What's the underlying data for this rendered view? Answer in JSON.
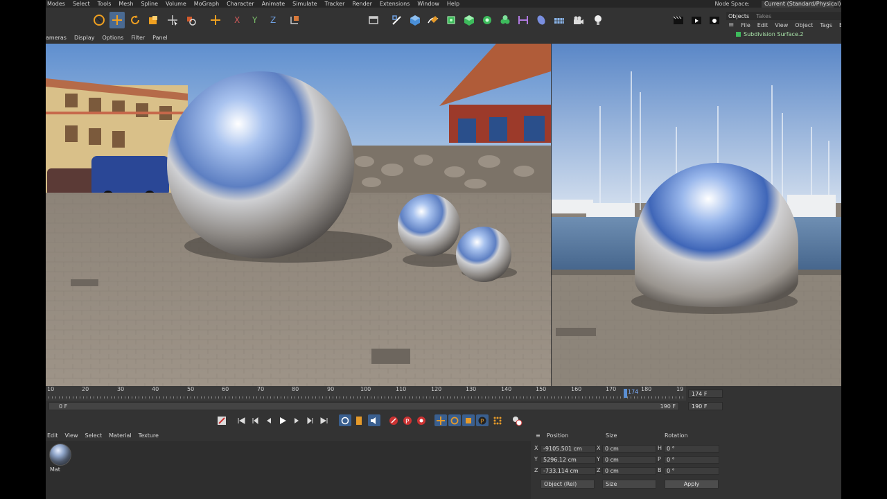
{
  "menubar": {
    "items": [
      "Modes",
      "Select",
      "Tools",
      "Mesh",
      "Spline",
      "Volume",
      "MoGraph",
      "Character",
      "Animate",
      "Simulate",
      "Tracker",
      "Render",
      "Extensions",
      "Window",
      "Help"
    ],
    "node_space_label": "Node Space:",
    "node_space_value": "Current (Standard/Physical)"
  },
  "viewport_menu": {
    "items": [
      "ameras",
      "Display",
      "Options",
      "Filter",
      "Panel"
    ]
  },
  "objects_panel": {
    "tabs": [
      "Objects",
      "Takes"
    ],
    "menu": [
      "File",
      "Edit",
      "View",
      "Object",
      "Tags",
      "Bo"
    ],
    "row_label": "Subdivision Surface.2"
  },
  "timeline": {
    "ticks": [
      "10",
      "20",
      "30",
      "40",
      "50",
      "60",
      "70",
      "80",
      "90",
      "100",
      "110",
      "120",
      "130",
      "140",
      "150",
      "160",
      "170",
      "180",
      "19"
    ],
    "current_frame_marker": "174",
    "current_frame": "174 F",
    "range_start": "0 F",
    "range_end": "190 F",
    "max_frame": "190 F"
  },
  "material": {
    "menu": [
      "Edit",
      "View",
      "Select",
      "Material",
      "Texture"
    ],
    "items": [
      {
        "name": "Mat"
      }
    ]
  },
  "coordinates": {
    "headers": {
      "position": "Position",
      "size": "Size",
      "rotation": "Rotation"
    },
    "rows": [
      {
        "axis": "X",
        "position": "-9105.501 cm",
        "size_axis": "X",
        "size": "0 cm",
        "rot_axis": "H",
        "rotation": "0 °"
      },
      {
        "axis": "Y",
        "position": "5296.12 cm",
        "size_axis": "Y",
        "size": "0 cm",
        "rot_axis": "P",
        "rotation": "0 °"
      },
      {
        "axis": "Z",
        "position": "-733.114 cm",
        "size_axis": "Z",
        "size": "0 cm",
        "rot_axis": "B",
        "rotation": "0 °"
      }
    ],
    "mode_select": "Object (Rel)",
    "size_select": "Size",
    "apply_label": "Apply"
  },
  "colors": {
    "accent": "#4a6a92",
    "ui_bg": "#333333",
    "menubar": "#262626"
  }
}
